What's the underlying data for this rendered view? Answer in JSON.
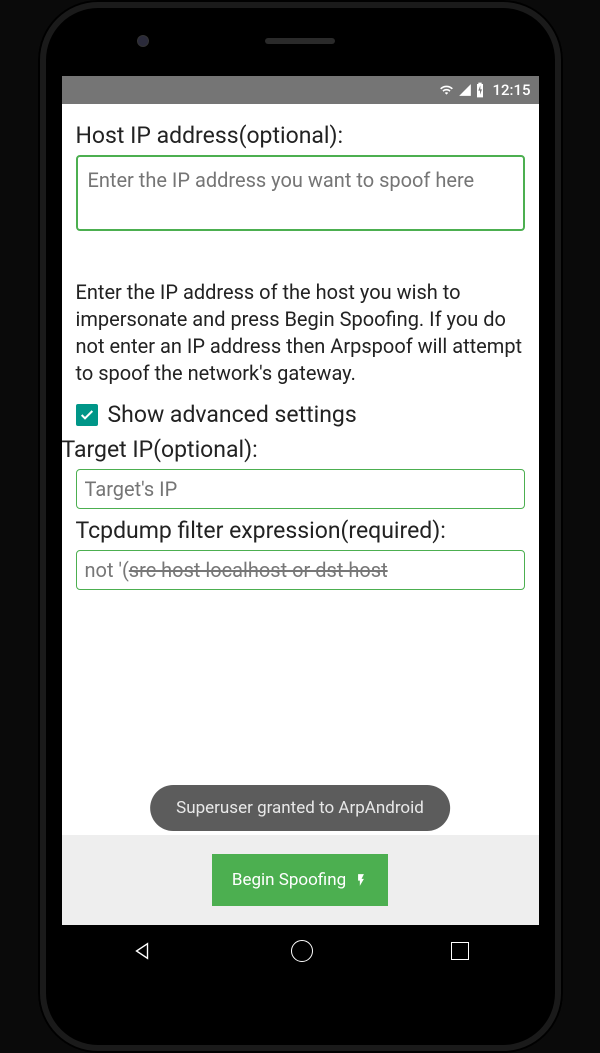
{
  "status": {
    "time": "12:15"
  },
  "hostIp": {
    "label": "Host IP address(optional):",
    "placeholder": "Enter the IP address you want to spoof here"
  },
  "helpText": "Enter the IP address of the host you wish to impersonate and press Begin Spoofing. If you do not enter an IP address then Arpspoof will attempt to spoof the network's gateway.",
  "advanced": {
    "checkboxLabel": "Show advanced settings",
    "checked": true
  },
  "targetIp": {
    "label": "Target IP(optional):",
    "placeholder": "Target's IP"
  },
  "filter": {
    "label": "Tcpdump filter expression(required):",
    "valuePrefix": "not '(",
    "valueStruck": "src host localhost or dst host"
  },
  "toast": "Superuser granted to ArpAndroid",
  "button": {
    "label": "Begin Spoofing"
  }
}
